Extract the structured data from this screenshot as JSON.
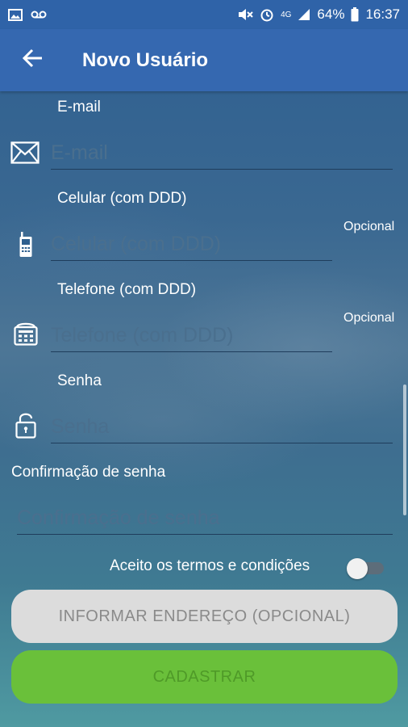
{
  "status_bar": {
    "battery": "64%",
    "time": "16:37",
    "network": "4G"
  },
  "app_bar": {
    "title": "Novo Usuário"
  },
  "form": {
    "email": {
      "label": "E-mail",
      "placeholder": "E-mail"
    },
    "cellphone": {
      "label": "Celular (com DDD)",
      "placeholder": "Celular (com DDD)",
      "optional": "Opcional"
    },
    "telephone": {
      "label": "Telefone (com DDD)",
      "placeholder": "Telefone (com DDD)",
      "optional": "Opcional"
    },
    "password": {
      "label": "Senha",
      "placeholder": "Senha"
    },
    "password_confirm": {
      "label": "Confirmação de senha",
      "placeholder": "Confirmação de senha"
    },
    "terms": {
      "label": "Aceito os termos e condições",
      "checked": false
    }
  },
  "buttons": {
    "address": "INFORMAR ENDEREÇO (OPCIONAL)",
    "register": "CADASTRAR"
  },
  "icons": {
    "back": "arrow-left-icon",
    "email": "envelope-icon",
    "cellphone": "mobile-phone-icon",
    "telephone": "desk-phone-icon",
    "password": "padlock-icon"
  },
  "colors": {
    "app_bar": "#3568b0",
    "status_bar": "#2f63a8",
    "register_button": "#6ac03a",
    "address_button": "#dcdcdc"
  }
}
